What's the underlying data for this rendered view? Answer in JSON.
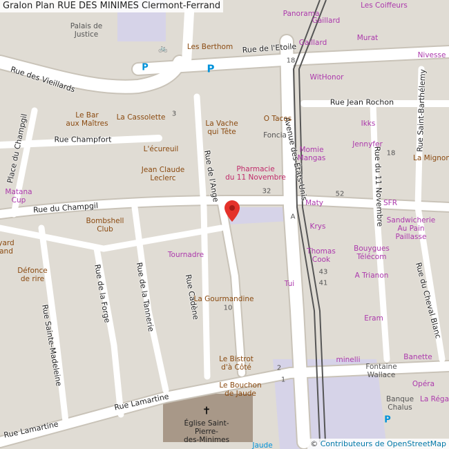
{
  "header": {
    "title": "Gralon Plan RUE DES MINIMES Clermont-Ferrand"
  },
  "attribution": {
    "symbol": "©",
    "link_text": "Contributeurs de OpenStreetMap"
  },
  "streets": {
    "vieillards": "Rue des Vieillards",
    "etoile": "Rue de l'Etoile",
    "jean_rochon": "Rue Jean Rochon",
    "champfort": "Rue Champfort",
    "champgil": "Rue du Champgil",
    "place_champgil": "Place du Champgil",
    "ange": "Rue de l'Ange",
    "etats_unis": "Avenue des États-Unis",
    "onze_novembre": "Rue du 11 Novembre",
    "saint_barthelemy": "Rue Saint-Barthélemy",
    "forge": "Rue de la Forge",
    "tannerie": "Rue de la Tannerie",
    "cadene": "Rue Cadène",
    "sainte_madeleine": "Rue Sainte-Madeleine",
    "lamartine1": "Rue Lamartine",
    "lamartine2": "Rue Lamartine",
    "cheval_blanc": "Rue du Cheval Blanc"
  },
  "pois": [
    {
      "id": "palais",
      "text": "Palais de\nJustice",
      "kind": "amen"
    },
    {
      "id": "berthom",
      "text": "Les Berthom",
      "kind": "food"
    },
    {
      "id": "panorama",
      "text": "Panorama",
      "kind": "shop"
    },
    {
      "id": "gaillard1",
      "text": "Gaillard",
      "kind": "shop"
    },
    {
      "id": "gaillard2",
      "text": "Gaillard",
      "kind": "shop"
    },
    {
      "id": "coiffeurs",
      "text": "Les Coiffeurs",
      "kind": "shop"
    },
    {
      "id": "murat",
      "text": "Murat",
      "kind": "shop"
    },
    {
      "id": "nivesse",
      "text": "Nivesse",
      "kind": "shop"
    },
    {
      "id": "withonor",
      "text": "WitHonor",
      "kind": "shop"
    },
    {
      "id": "bar_maitres",
      "text": "Le Bar\naux Maîtres",
      "kind": "food"
    },
    {
      "id": "cassolette",
      "text": "La Cassolette",
      "kind": "food"
    },
    {
      "id": "vache",
      "text": "La Vache\nqui Tête",
      "kind": "food"
    },
    {
      "id": "otacos",
      "text": "O Tacos",
      "kind": "food"
    },
    {
      "id": "foncia",
      "text": "Foncia",
      "kind": "amen"
    },
    {
      "id": "ikks",
      "text": "Ikks",
      "kind": "shop"
    },
    {
      "id": "jennyfer",
      "text": "Jennyfer",
      "kind": "shop"
    },
    {
      "id": "mignon",
      "text": "La Mignon",
      "kind": "food"
    },
    {
      "id": "ecureuil",
      "text": "L'écureuil",
      "kind": "food"
    },
    {
      "id": "jcleclerc",
      "text": "Jean Claude\nLeclerc",
      "kind": "food"
    },
    {
      "id": "pharmacie",
      "text": "Pharmacie\ndu 11 Novembre",
      "kind": "health"
    },
    {
      "id": "momie",
      "text": "Momie\nMangas",
      "kind": "shop"
    },
    {
      "id": "matana",
      "text": "Matana\nCup",
      "kind": "shop"
    },
    {
      "id": "maty",
      "text": "Maty",
      "kind": "shop"
    },
    {
      "id": "sfr",
      "text": "SFR",
      "kind": "shop"
    },
    {
      "id": "bombshell",
      "text": "Bombshell\nClub",
      "kind": "food"
    },
    {
      "id": "krys",
      "text": "Krys",
      "kind": "shop"
    },
    {
      "id": "sandwicherie",
      "text": "Sandwicherie\nAu Pain\nPaillasse",
      "kind": "shop"
    },
    {
      "id": "yard",
      "text": "yard\nand",
      "kind": "food"
    },
    {
      "id": "tournadre",
      "text": "Tournadre",
      "kind": "shop"
    },
    {
      "id": "thomascook",
      "text": "Thomas\nCook",
      "kind": "shop"
    },
    {
      "id": "bouygues",
      "text": "Bouygues\nTélécom",
      "kind": "shop"
    },
    {
      "id": "defonce",
      "text": "Défonce\nde rire",
      "kind": "food"
    },
    {
      "id": "tui",
      "text": "Tui",
      "kind": "shop"
    },
    {
      "id": "atrianon",
      "text": "A Trianon",
      "kind": "shop"
    },
    {
      "id": "gourmandine",
      "text": "La Gourmandine",
      "kind": "food"
    },
    {
      "id": "eram",
      "text": "Eram",
      "kind": "shop"
    },
    {
      "id": "banette",
      "text": "Banette",
      "kind": "shop"
    },
    {
      "id": "bistrot",
      "text": "Le Bistrot\nd'à Côté",
      "kind": "food"
    },
    {
      "id": "minelli",
      "text": "minelli",
      "kind": "shop"
    },
    {
      "id": "fontaine",
      "text": "Fontaine\nWallace",
      "kind": "amen"
    },
    {
      "id": "opera",
      "text": "Opéra",
      "kind": "shop"
    },
    {
      "id": "bouchon",
      "text": "Le Bouchon\nde Jaude",
      "kind": "food"
    },
    {
      "id": "banque",
      "text": "Banque\nChalus",
      "kind": "amen"
    },
    {
      "id": "larega",
      "text": "La Réga",
      "kind": "shop"
    },
    {
      "id": "eglise",
      "text": "Église Saint-\nPierre-\ndes-Minimes",
      "kind": "amen"
    },
    {
      "id": "jaude",
      "text": "Jaude",
      "kind": "park"
    }
  ],
  "house_numbers": [
    {
      "id": "n3",
      "text": "3"
    },
    {
      "id": "n18",
      "text": "18"
    },
    {
      "id": "n32",
      "text": "32"
    },
    {
      "id": "n52",
      "text": "52"
    },
    {
      "id": "n18b",
      "text": "18"
    },
    {
      "id": "n43",
      "text": "43"
    },
    {
      "id": "n41",
      "text": "41"
    },
    {
      "id": "n10",
      "text": "10"
    },
    {
      "id": "n2",
      "text": "2"
    },
    {
      "id": "n1",
      "text": "1"
    },
    {
      "id": "nA",
      "text": "A"
    }
  ],
  "icons": [
    {
      "id": "p1",
      "glyph": "P",
      "kind": "park"
    },
    {
      "id": "p2",
      "glyph": "P",
      "kind": "park"
    },
    {
      "id": "p3",
      "glyph": "P",
      "kind": "park"
    },
    {
      "id": "bike1",
      "glyph": "🚲",
      "kind": "park"
    },
    {
      "id": "church",
      "glyph": "✝",
      "kind": "amen"
    }
  ],
  "colors": {
    "road": "#ffffff",
    "road_casing": "#c9c3b8",
    "building": "#d8d0c6",
    "block": "#e0dcd4",
    "church": "#a89888",
    "tram": "#555555",
    "square": "#d6d3e8",
    "park_icon": "#0092da",
    "shop_poi": "#ac39ac",
    "food_poi": "#8a4a10",
    "marker": "#e4322b"
  }
}
